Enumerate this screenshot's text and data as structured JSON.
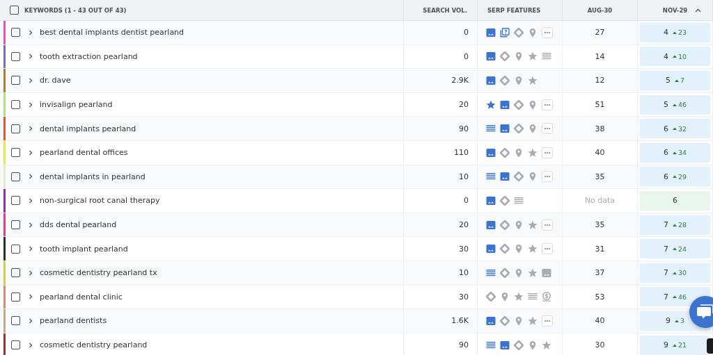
{
  "header": {
    "keywords": "KEYWORDS (1 - 43 OUT OF 43)",
    "search_vol": "SEARCH VOL.",
    "serp": "SERP FEATURES",
    "date_1": "AUG-30",
    "date_2": "NOV-29",
    "select_all": false,
    "date_2_sorted": true
  },
  "rows": [
    {
      "keyword": "best dental implants dentist pearland",
      "color": "#e84fc0",
      "checked": false,
      "volume": "0",
      "features": [
        {
          "kind": "image",
          "active": true
        },
        {
          "kind": "faq",
          "active": true
        },
        {
          "kind": "diamond",
          "active": false
        },
        {
          "kind": "pin",
          "active": false
        },
        {
          "kind": "more",
          "active": false
        }
      ],
      "date_1": "27",
      "date_1_missing": false,
      "rank": "4",
      "change": "23",
      "new_entry": false
    },
    {
      "keyword": "tooth extraction pearland",
      "color": "#6b6fc8",
      "checked": false,
      "volume": "0",
      "features": [
        {
          "kind": "image",
          "active": true
        },
        {
          "kind": "diamond",
          "active": false
        },
        {
          "kind": "pin",
          "active": false
        },
        {
          "kind": "star",
          "active": false
        },
        {
          "kind": "list",
          "active": false
        }
      ],
      "date_1": "14",
      "date_1_missing": false,
      "rank": "4",
      "change": "10",
      "new_entry": false
    },
    {
      "keyword": "dr. dave",
      "color": "#b07a2f",
      "checked": false,
      "volume": "2.9K",
      "features": [
        {
          "kind": "image",
          "active": true
        },
        {
          "kind": "diamond",
          "active": false
        },
        {
          "kind": "pin",
          "active": false
        },
        {
          "kind": "star",
          "active": false
        }
      ],
      "date_1": "12",
      "date_1_missing": false,
      "rank": "5",
      "change": "7",
      "new_entry": false
    },
    {
      "keyword": "invisalign pearland",
      "color": "#a8e58a",
      "checked": false,
      "volume": "20",
      "features": [
        {
          "kind": "star",
          "active": true
        },
        {
          "kind": "image",
          "active": true
        },
        {
          "kind": "diamond",
          "active": false
        },
        {
          "kind": "pin",
          "active": false
        },
        {
          "kind": "more",
          "active": false
        }
      ],
      "date_1": "51",
      "date_1_missing": false,
      "rank": "5",
      "change": "46",
      "new_entry": false
    },
    {
      "keyword": "dental implants pearland",
      "color": "#e8503a",
      "checked": false,
      "volume": "90",
      "features": [
        {
          "kind": "list",
          "active": true
        },
        {
          "kind": "image",
          "active": true
        },
        {
          "kind": "diamond",
          "active": false
        },
        {
          "kind": "pin",
          "active": false
        },
        {
          "kind": "more",
          "active": false
        }
      ],
      "date_1": "38",
      "date_1_missing": false,
      "rank": "6",
      "change": "32",
      "new_entry": false
    },
    {
      "keyword": "pearland dental offices",
      "color": "#e8e84a",
      "checked": false,
      "volume": "110",
      "features": [
        {
          "kind": "image",
          "active": true
        },
        {
          "kind": "diamond",
          "active": false
        },
        {
          "kind": "pin",
          "active": false
        },
        {
          "kind": "star",
          "active": false
        },
        {
          "kind": "more",
          "active": false
        }
      ],
      "date_1": "40",
      "date_1_missing": false,
      "rank": "6",
      "change": "34",
      "new_entry": false
    },
    {
      "keyword": "dental implants in pearland",
      "color": "#d8f0d0",
      "checked": false,
      "volume": "10",
      "features": [
        {
          "kind": "list",
          "active": true
        },
        {
          "kind": "image",
          "active": true
        },
        {
          "kind": "diamond",
          "active": false
        },
        {
          "kind": "pin",
          "active": false
        },
        {
          "kind": "more",
          "active": false
        }
      ],
      "date_1": "35",
      "date_1_missing": false,
      "rank": "6",
      "change": "29",
      "new_entry": false
    },
    {
      "keyword": "non-surgical root canal therapy",
      "color": "#8b2fc0",
      "checked": false,
      "volume": "0",
      "features": [
        {
          "kind": "image",
          "active": true
        },
        {
          "kind": "diamond",
          "active": false
        },
        {
          "kind": "list",
          "active": false
        }
      ],
      "date_1": "No data",
      "date_1_missing": true,
      "rank": "6",
      "new_entry": true
    },
    {
      "keyword": "dds dental pearland",
      "color": "#e83a8a",
      "checked": false,
      "volume": "20",
      "features": [
        {
          "kind": "image",
          "active": true
        },
        {
          "kind": "diamond",
          "active": false
        },
        {
          "kind": "pin",
          "active": false
        },
        {
          "kind": "star",
          "active": false
        },
        {
          "kind": "more",
          "active": false
        }
      ],
      "date_1": "35",
      "date_1_missing": false,
      "rank": "7",
      "change": "28",
      "new_entry": false
    },
    {
      "keyword": "tooth implant pearland",
      "color": "#1a3a1a",
      "checked": false,
      "volume": "30",
      "features": [
        {
          "kind": "image",
          "active": true
        },
        {
          "kind": "diamond",
          "active": false
        },
        {
          "kind": "pin",
          "active": false
        },
        {
          "kind": "star",
          "active": false
        },
        {
          "kind": "more",
          "active": false
        }
      ],
      "date_1": "31",
      "date_1_missing": false,
      "rank": "7",
      "change": "24",
      "new_entry": false
    },
    {
      "keyword": "cosmetic dentistry pearland tx",
      "color": "#d4cf4a",
      "checked": false,
      "volume": "10",
      "features": [
        {
          "kind": "list",
          "active": true
        },
        {
          "kind": "diamond",
          "active": false
        },
        {
          "kind": "pin",
          "active": false
        },
        {
          "kind": "star",
          "active": false
        },
        {
          "kind": "image",
          "active": false
        }
      ],
      "date_1": "37",
      "date_1_missing": false,
      "rank": "7",
      "change": "30",
      "new_entry": false
    },
    {
      "keyword": "pearland dental clinic",
      "color": "#d48a7a",
      "checked": false,
      "volume": "30",
      "features": [
        {
          "kind": "diamond",
          "active": false
        },
        {
          "kind": "pin",
          "active": false
        },
        {
          "kind": "star",
          "active": false
        },
        {
          "kind": "list",
          "active": false
        },
        {
          "kind": "dollar",
          "active": false
        }
      ],
      "date_1": "53",
      "date_1_missing": false,
      "rank": "7",
      "change": "46",
      "new_entry": false
    },
    {
      "keyword": "pearland dentists",
      "color": "#b8b08a",
      "checked": false,
      "volume": "1.6K",
      "features": [
        {
          "kind": "image",
          "active": true
        },
        {
          "kind": "diamond",
          "active": false
        },
        {
          "kind": "pin",
          "active": false
        },
        {
          "kind": "star",
          "active": false
        },
        {
          "kind": "more",
          "active": false
        }
      ],
      "date_1": "40",
      "date_1_missing": false,
      "rank": "9",
      "change": "3",
      "new_entry": false
    },
    {
      "keyword": "cosmetic dentistry pearland",
      "color": "#a0302a",
      "checked": false,
      "volume": "90",
      "features": [
        {
          "kind": "list",
          "active": true
        },
        {
          "kind": "image",
          "active": true
        },
        {
          "kind": "diamond",
          "active": false
        },
        {
          "kind": "pin",
          "active": false
        },
        {
          "kind": "star",
          "active": false
        }
      ],
      "date_1": "30",
      "date_1_missing": false,
      "rank": "9",
      "change": "21",
      "new_entry": false
    }
  ]
}
